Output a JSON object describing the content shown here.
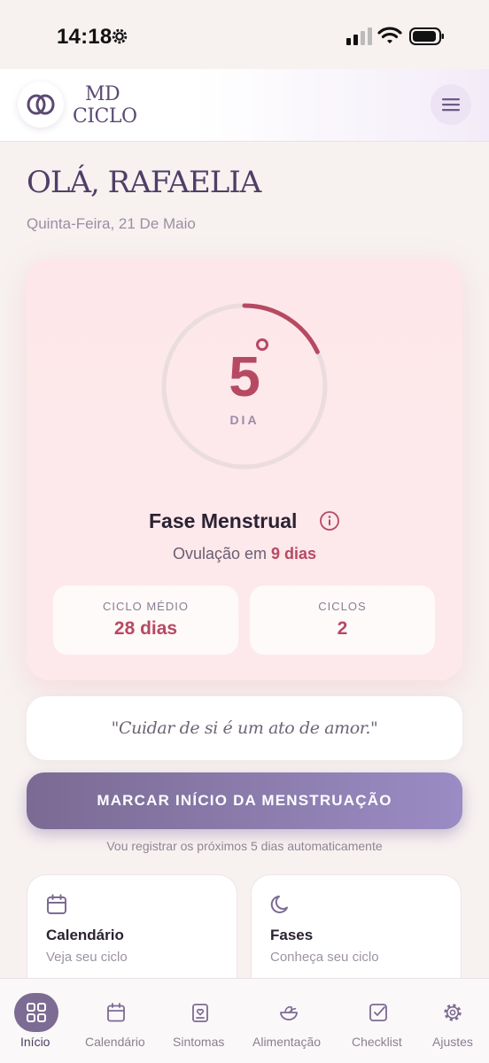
{
  "status_bar": {
    "time": "14:18"
  },
  "header": {
    "brand_line1": "MD",
    "brand_line2": "CICLO"
  },
  "greeting": {
    "title": "OLÁ, RAFAELIA",
    "date": "Quinta-Feira, 21 De Maio"
  },
  "cycle": {
    "day": "5",
    "day_label": "DIA",
    "progress": 0.18,
    "phase": "Fase Menstrual",
    "ovulation_prefix": "Ovulação em",
    "ovulation_days": "9 dias",
    "stats": [
      {
        "label": "CICLO MÉDIO",
        "value": "28 dias"
      },
      {
        "label": "CICLOS",
        "value": "2"
      }
    ]
  },
  "quote": "\"Cuidar de si é um ato de amor.\"",
  "actions": {
    "mark_period": "MARCAR INÍCIO DA MENSTRUAÇÃO",
    "auto_note": "Vou registrar os próximos 5 dias automaticamente"
  },
  "quick_cards": [
    {
      "title": "Calendário",
      "subtitle": "Veja seu ciclo",
      "icon": "calendar-icon"
    },
    {
      "title": "Fases",
      "subtitle": "Conheça seu ciclo",
      "icon": "moon-icon"
    }
  ],
  "nav": [
    {
      "label": "Início",
      "icon": "grid-icon",
      "active": true
    },
    {
      "label": "Calendário",
      "icon": "calendar-icon"
    },
    {
      "label": "Sintomas",
      "icon": "clipboard-heart-icon"
    },
    {
      "label": "Alimentação",
      "icon": "salad-icon"
    },
    {
      "label": "Checklist",
      "icon": "checkbox-icon"
    },
    {
      "label": "Ajustes",
      "icon": "gear-icon"
    }
  ],
  "colors": {
    "accent": "#b64a62",
    "primary": "#7c6b93",
    "brand": "#5b4a72"
  }
}
